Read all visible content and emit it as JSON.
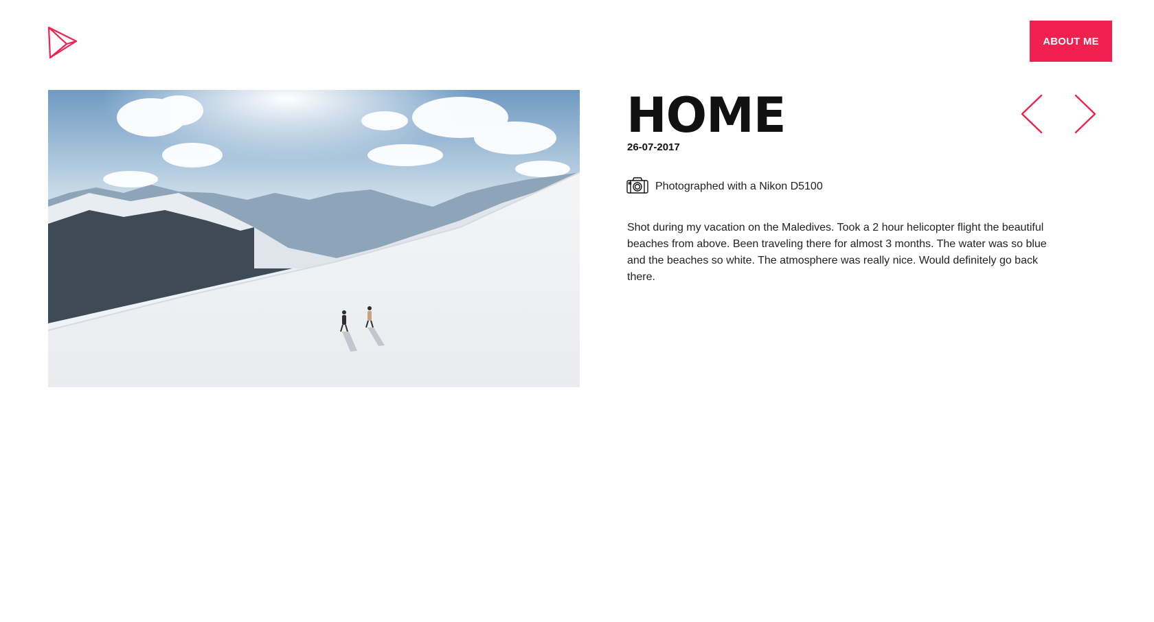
{
  "header": {
    "about_label": "ABOUT ME"
  },
  "post": {
    "title": "HOME",
    "date": "26-07-2017",
    "camera_text": "Photographed with a Nikon D5100",
    "description": "Shot during my vacation on the Maledives. Took a 2 hour helicopter flight the beautiful beaches from above. Been traveling there for almost 3 months. The water was so blue and the beaches so white. The atmosphere was really nice. Would definitely go back there."
  },
  "icons": {
    "logo": "logo-flag-icon",
    "camera": "camera-icon",
    "prev": "chevron-left-icon",
    "next": "chevron-right-icon"
  },
  "colors": {
    "accent": "#f0214f",
    "text": "#111111"
  }
}
